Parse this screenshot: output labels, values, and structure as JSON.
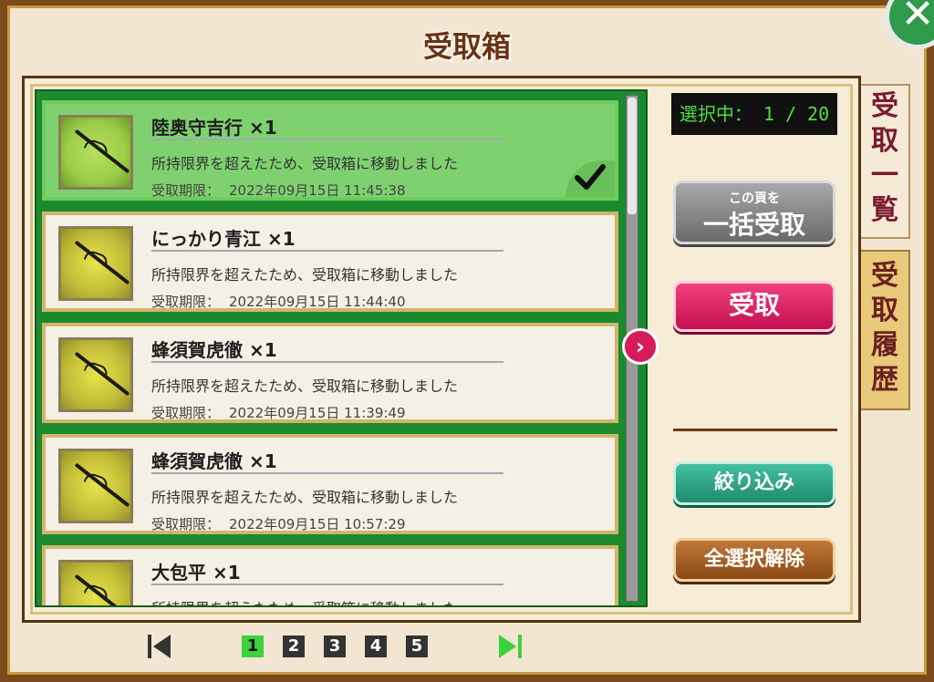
{
  "window": {
    "title": "受取箱"
  },
  "counter": {
    "label": "選択中：",
    "value": "1 / 20"
  },
  "items": [
    {
      "name": "陸奥守吉行 ×1",
      "message": "所持限界を超えたため、受取箱に移動しました",
      "deadline_label": "受取期限：",
      "deadline": "2022年09月15日 11:45:38",
      "selected": true
    },
    {
      "name": "にっかり青江 ×1",
      "message": "所持限界を超えたため、受取箱に移動しました",
      "deadline_label": "受取期限：",
      "deadline": "2022年09月15日 11:44:40",
      "selected": false
    },
    {
      "name": "蜂須賀虎徹 ×1",
      "message": "所持限界を超えたため、受取箱に移動しました",
      "deadline_label": "受取期限：",
      "deadline": "2022年09月15日 11:39:49",
      "selected": false
    },
    {
      "name": "蜂須賀虎徹 ×1",
      "message": "所持限界を超えたため、受取箱に移動しました",
      "deadline_label": "受取期限：",
      "deadline": "2022年09月15日 10:57:29",
      "selected": false
    },
    {
      "name": "大包平 ×1",
      "message": "所持限界を超えたため、受取箱に移動しました",
      "deadline_label": "",
      "deadline": "",
      "selected": false
    }
  ],
  "buttons": {
    "bulk_small": "この頁を",
    "bulk_big": "一括受取",
    "receive": "受取",
    "filter": "絞り込み",
    "clear_all": "全選択解除"
  },
  "tabs": {
    "list": "受取一覧",
    "history": "受取履歴"
  },
  "pagination": {
    "pages": [
      "1",
      "2",
      "3",
      "4",
      "5"
    ],
    "current": "1"
  },
  "colors": {
    "accent_green": "#3bd23b",
    "receive_pink": "#d61a5a",
    "frame_brown": "#7a4a1c"
  }
}
